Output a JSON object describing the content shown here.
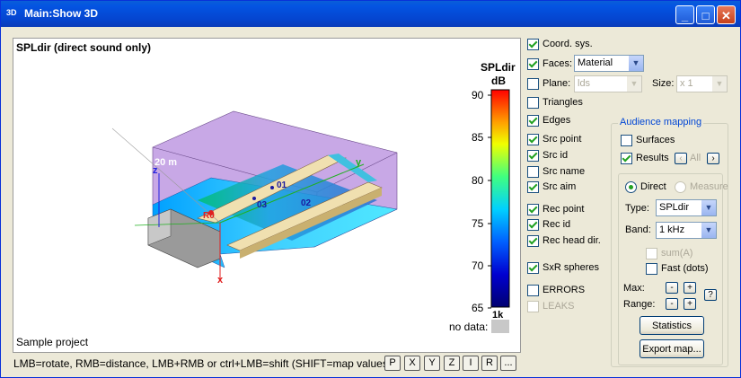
{
  "window": {
    "title": "Main:Show 3D",
    "icon": "3D",
    "min": "_",
    "max": "□",
    "close": "✕"
  },
  "view": {
    "title": "SPLdir (direct sound only)",
    "project": "Sample project",
    "scale_label": "SPLdir",
    "scale_unit": "dB",
    "scale_ticks": [
      "90",
      "85",
      "80",
      "75",
      "70",
      "65"
    ],
    "band_label": "1k",
    "nodata_label": "no data:",
    "dist_label": "20 m",
    "axis_x": "x",
    "axis_y": "y",
    "axis_z": "z",
    "src_labels": [
      "01",
      "02",
      "03"
    ],
    "rec_label": "R0"
  },
  "status": "LMB=rotate, RMB=distance, LMB+RMB or ctrl+LMB=shift (SHIFT=map values)",
  "axis_buttons": [
    "P",
    "X",
    "Y",
    "Z",
    "I",
    "R",
    "..."
  ],
  "panel": {
    "coord_sys": "Coord. sys.",
    "faces": "Faces:",
    "faces_value": "Material",
    "plane": "Plane:",
    "plane_value": "lds",
    "size": "Size:",
    "size_value": "x 1",
    "triangles": "Triangles",
    "edges": "Edges",
    "src_point": "Src point",
    "src_id": "Src id",
    "src_name": "Src name",
    "src_aim": "Src aim",
    "rec_point": "Rec point",
    "rec_id": "Rec id",
    "rec_head": "Rec head dir.",
    "sxr": "SxR spheres",
    "errors": "ERRORS",
    "leaks": "LEAKS",
    "audience": {
      "legend": "Audience mapping",
      "surfaces": "Surfaces",
      "results": "Results",
      "all": "All",
      "direct": "Direct",
      "measure": "Measure",
      "type": "Type:",
      "type_value": "SPLdir",
      "band": "Band:",
      "band_value": "1 kHz",
      "sum": "sum(A)",
      "fast": "Fast (dots)",
      "max": "Max:",
      "range": "Range:",
      "minus": "-",
      "plus": "+",
      "help": "?",
      "statistics": "Statistics",
      "export": "Export map..."
    }
  }
}
